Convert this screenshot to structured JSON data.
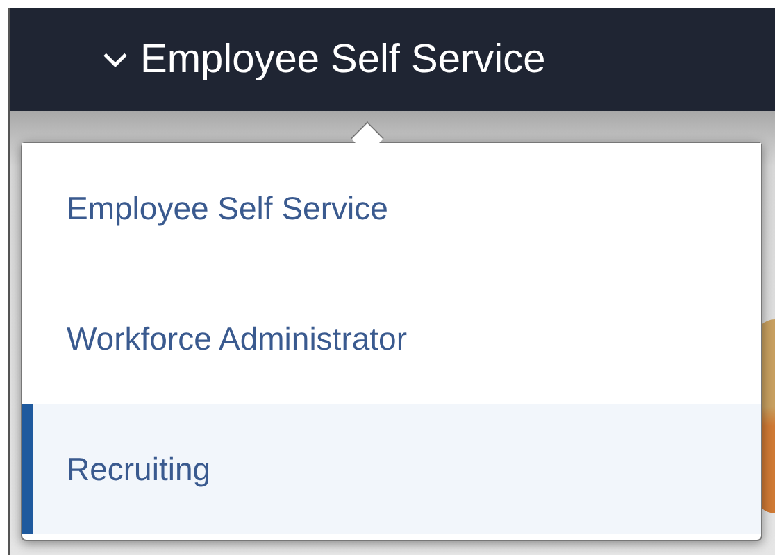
{
  "header": {
    "title": "Employee Self Service",
    "expanded": true
  },
  "menu": {
    "items": [
      {
        "label": "Employee Self Service",
        "selected": false
      },
      {
        "label": "Workforce Administrator",
        "selected": false
      },
      {
        "label": "Recruiting",
        "selected": true
      }
    ]
  }
}
